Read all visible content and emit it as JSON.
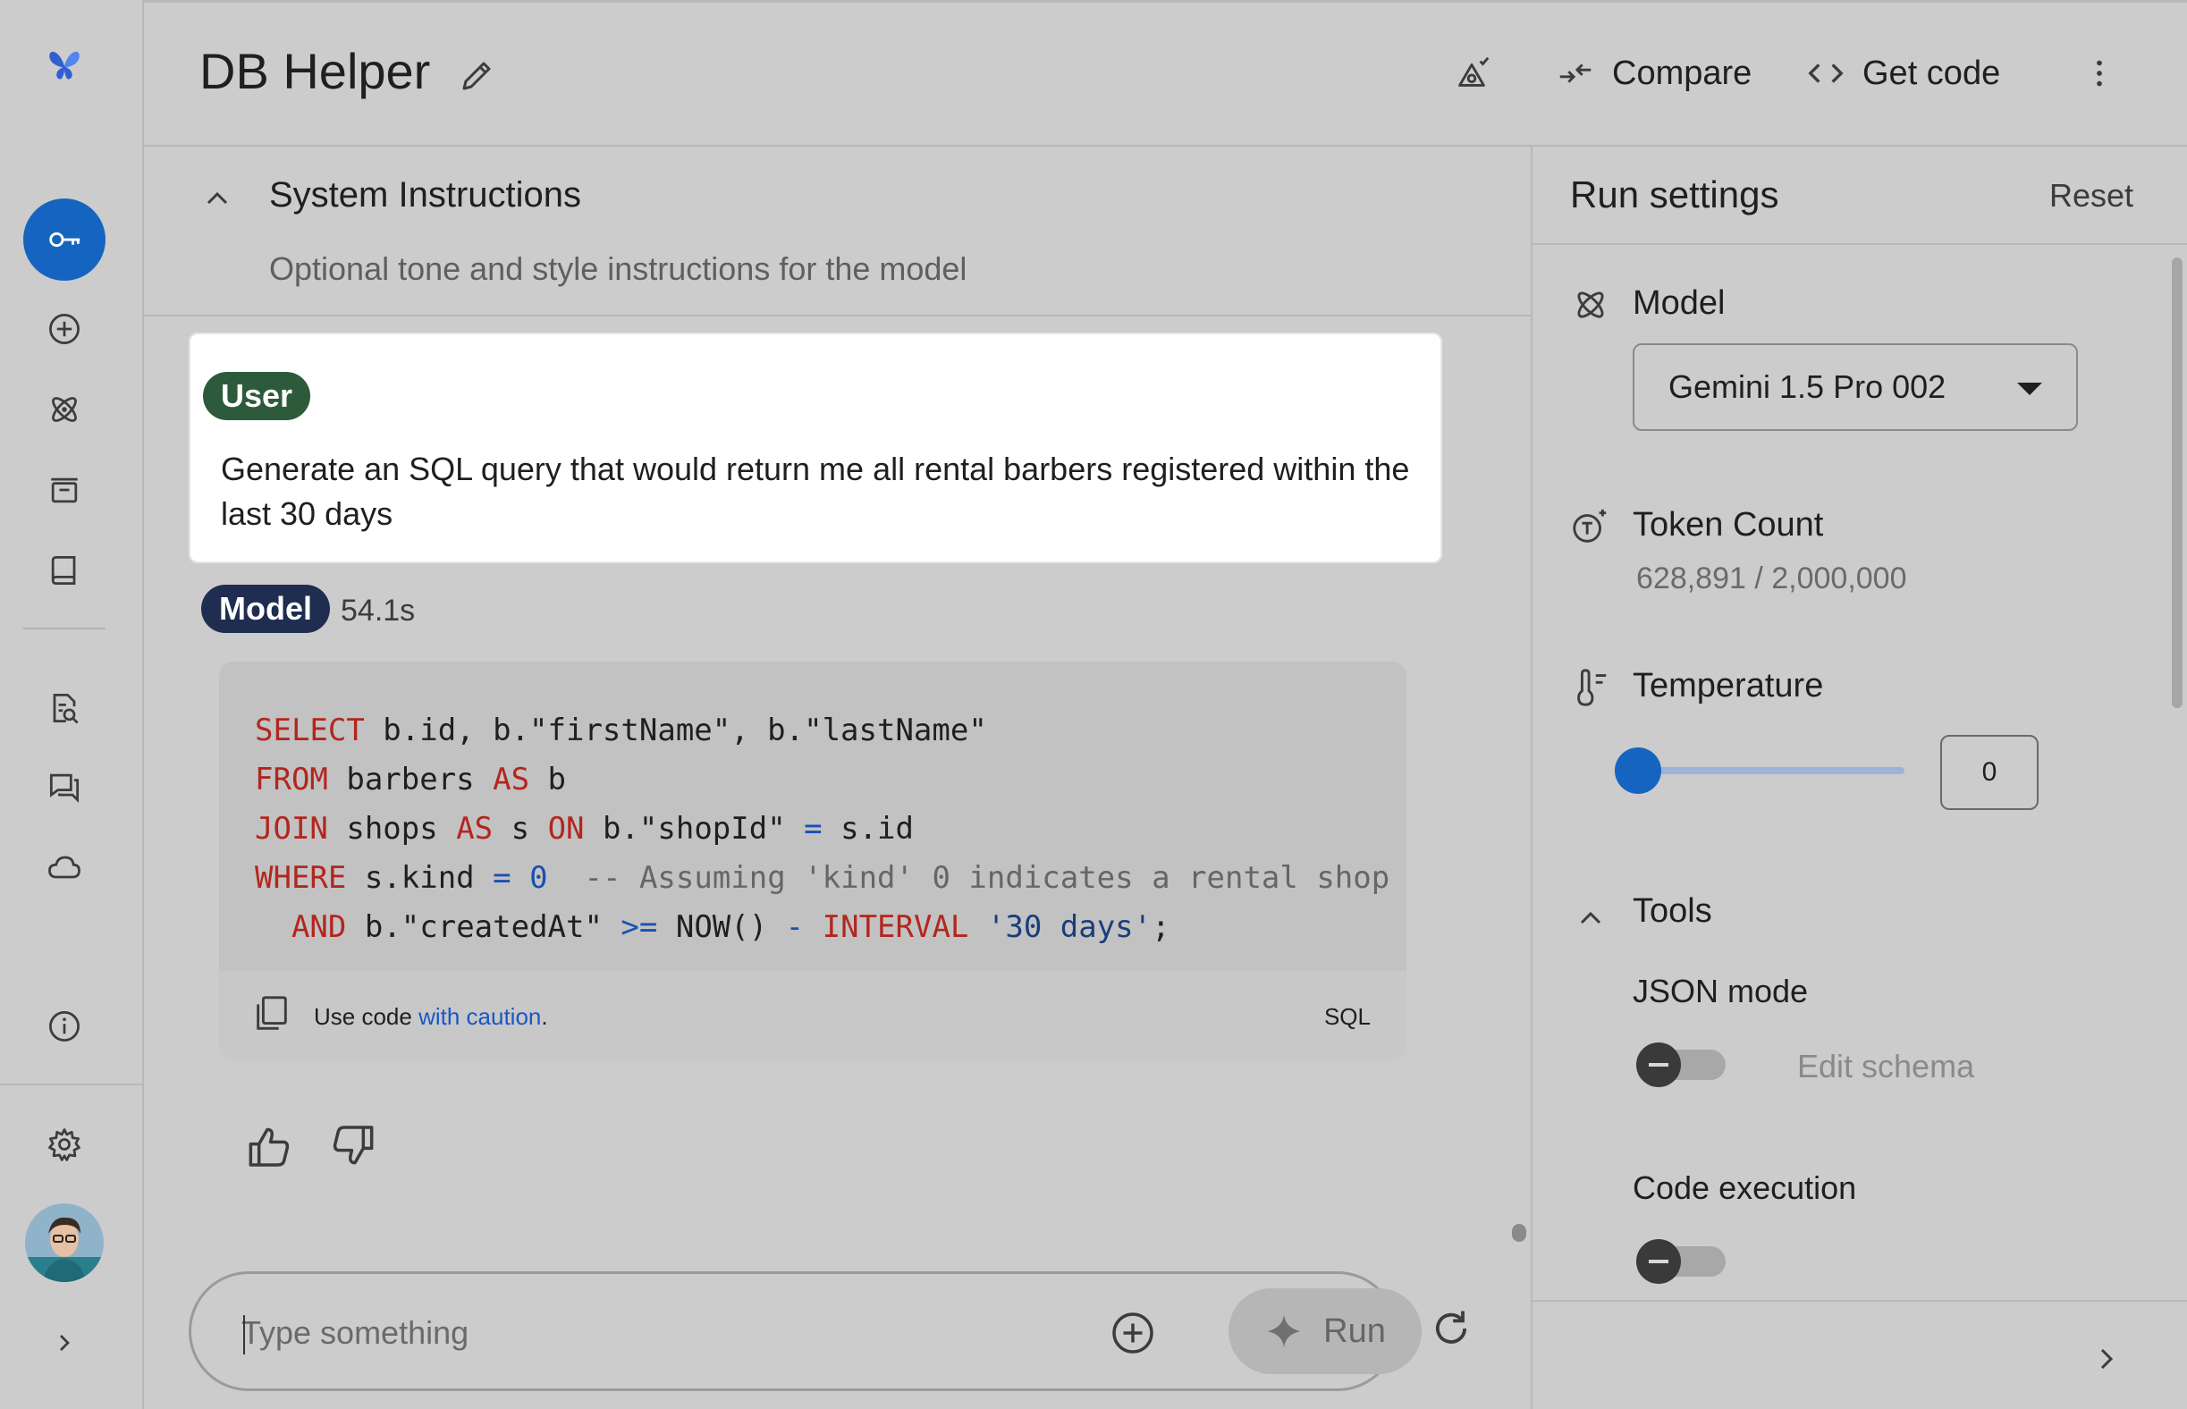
{
  "app": {
    "title": "DB Helper"
  },
  "header": {
    "compare_label": "Compare",
    "get_code_label": "Get code"
  },
  "system_instructions": {
    "title": "System Instructions",
    "placeholder": "Optional tone and style instructions for the model"
  },
  "chat": {
    "user_badge": "User",
    "user_message": "Generate an SQL query that would return me all rental barbers registered within the last 30 days",
    "model_badge": "Model",
    "model_duration": "54.1s",
    "code": {
      "language": "SQL",
      "caution_prefix": "Use code ",
      "caution_link": "with caution",
      "caution_suffix": ".",
      "lines": [
        "SELECT b.id, b.\"firstName\", b.\"lastName\"",
        "FROM barbers AS b",
        "JOIN shops AS s ON b.\"shopId\" = s.id",
        "WHERE s.kind = 0  -- Assuming 'kind' 0 indicates a rental shop",
        "  AND b.\"createdAt\" >= NOW() - INTERVAL '30 days';"
      ]
    }
  },
  "composer": {
    "placeholder": "Type something",
    "run_label": "Run"
  },
  "run_settings": {
    "title": "Run settings",
    "reset_label": "Reset",
    "model_label": "Model",
    "model_selected": "Gemini 1.5 Pro 002",
    "token_count_label": "Token Count",
    "token_count_value": "628,891 / 2,000,000",
    "temperature_label": "Temperature",
    "temperature_value": "0",
    "temperature_fraction": 0,
    "tools_label": "Tools",
    "json_mode_label": "JSON mode",
    "json_mode_enabled": false,
    "edit_schema_label": "Edit schema",
    "code_execution_label": "Code execution",
    "code_execution_enabled": false
  },
  "colors": {
    "accent": "#1565c0",
    "user_badge": "#2e5a3c",
    "model_badge": "#1e2d50",
    "sql_keyword": "#b3261e",
    "link": "#1a56c8"
  },
  "icons": {
    "rail": [
      "butterfly-logo-icon",
      "key-icon",
      "add-circle-icon",
      "atom-icon",
      "archive-icon",
      "book-icon",
      "doc-search-icon",
      "forum-icon",
      "cloud-icon",
      "info-icon",
      "settings-icon",
      "chevron-right-icon"
    ]
  }
}
